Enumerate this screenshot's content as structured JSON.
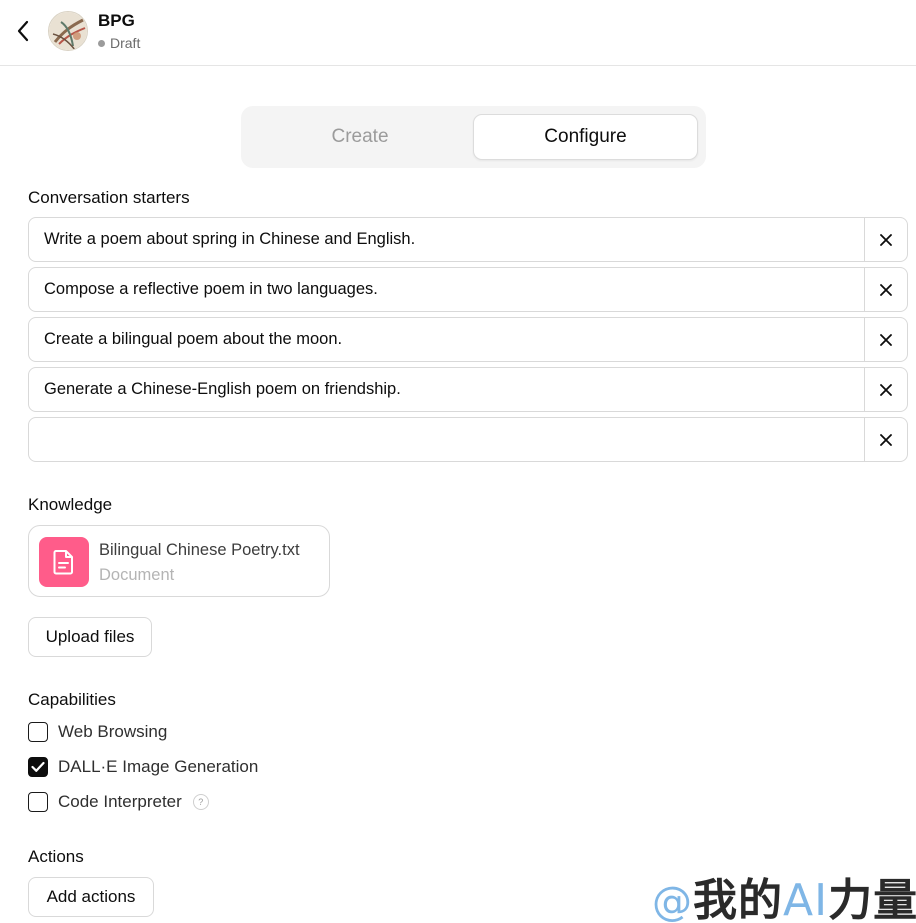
{
  "header": {
    "title": "BPG",
    "status": "Draft"
  },
  "tabs": [
    {
      "label": "Create",
      "active": false
    },
    {
      "label": "Configure",
      "active": true
    }
  ],
  "conversation_starters": {
    "label": "Conversation starters",
    "items": [
      "Write a poem about spring in Chinese and English.",
      "Compose a reflective poem in two languages.",
      "Create a bilingual poem about the moon.",
      "Generate a Chinese-English poem on friendship.",
      ""
    ]
  },
  "knowledge": {
    "label": "Knowledge",
    "file": {
      "name": "Bilingual Chinese Poetry.txt",
      "type": "Document",
      "icon": "document-icon",
      "icon_color": "#ff5c8a"
    },
    "upload_label": "Upload files"
  },
  "capabilities": {
    "label": "Capabilities",
    "items": [
      {
        "label": "Web Browsing",
        "checked": false
      },
      {
        "label": "DALL·E Image Generation",
        "checked": true
      },
      {
        "label": "Code Interpreter",
        "checked": false,
        "help": "?"
      }
    ]
  },
  "actions": {
    "label": "Actions",
    "add_label": "Add actions"
  },
  "watermark": {
    "at": "@",
    "cn1": "我的",
    "ai": "AI",
    "cn2": "力量"
  }
}
